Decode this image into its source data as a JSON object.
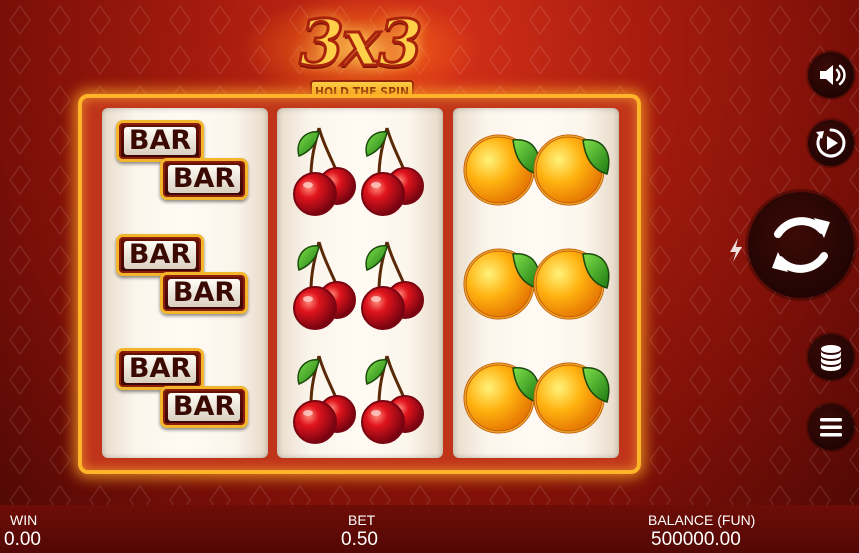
{
  "logo": {
    "title": "3x3",
    "subtitle": "HOLD THE SPIN"
  },
  "reels": [
    {
      "symbol": "bar",
      "label": "BAR",
      "rows": 3
    },
    {
      "symbol": "cherry-icon",
      "rows": 3
    },
    {
      "symbol": "orange-icon",
      "rows": 3
    }
  ],
  "controls": {
    "sound": "speaker-icon",
    "autoplay": "autoplay-icon",
    "turbo": "lightning-icon",
    "spin": "spin-arrows-icon",
    "bet": "coin-stack-icon",
    "menu": "hamburger-menu-icon"
  },
  "footer": {
    "win_label": "WIN",
    "win_value": "0.00",
    "bet_label": "BET",
    "bet_value": "0.50",
    "balance_label": "BALANCE (FUN)",
    "balance_value": "500000.00"
  },
  "colors": {
    "frame": "#ffb42a",
    "background": "#a81c0e",
    "footer": "#5e0a06"
  }
}
